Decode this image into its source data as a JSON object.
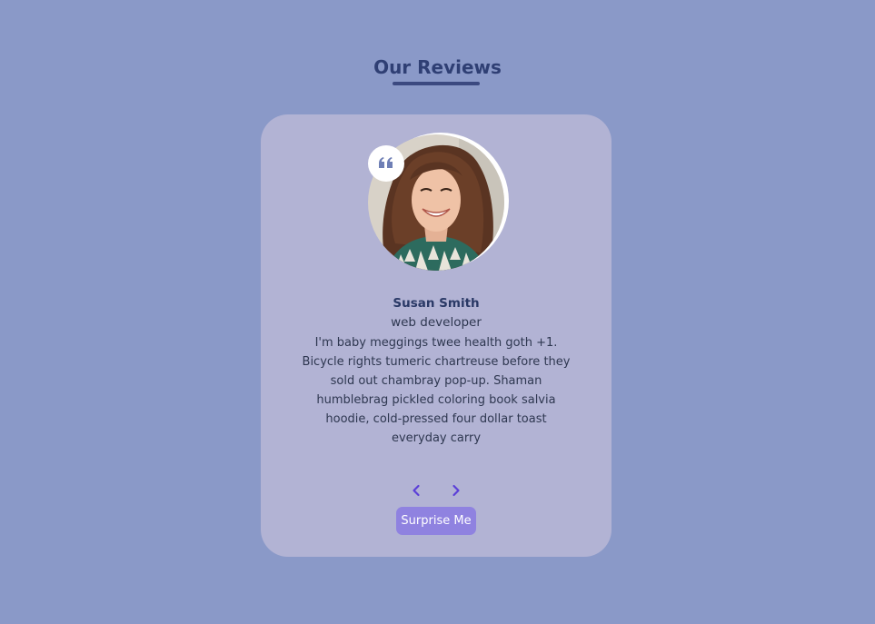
{
  "header": {
    "title": "Our Reviews"
  },
  "review": {
    "name": "Susan Smith",
    "job": "web developer",
    "text": "I'm baby meggings twee health goth +1. Bicycle rights tumeric chartreuse before they sold out chambray pop-up. Shaman humblebrag pickled coloring book salvia hoodie, cold-pressed four dollar toast everyday carry",
    "avatar_alt": "Susan Smith"
  },
  "controls": {
    "prev_icon": "chevron-left-icon",
    "next_icon": "chevron-right-icon",
    "surprise_label": "Surprise Me"
  },
  "colors": {
    "background": "#8a99c8",
    "card": "#b2b3d4",
    "title": "#2f3f74",
    "accent": "#8f82e0",
    "chevron": "#5b3fd8"
  }
}
